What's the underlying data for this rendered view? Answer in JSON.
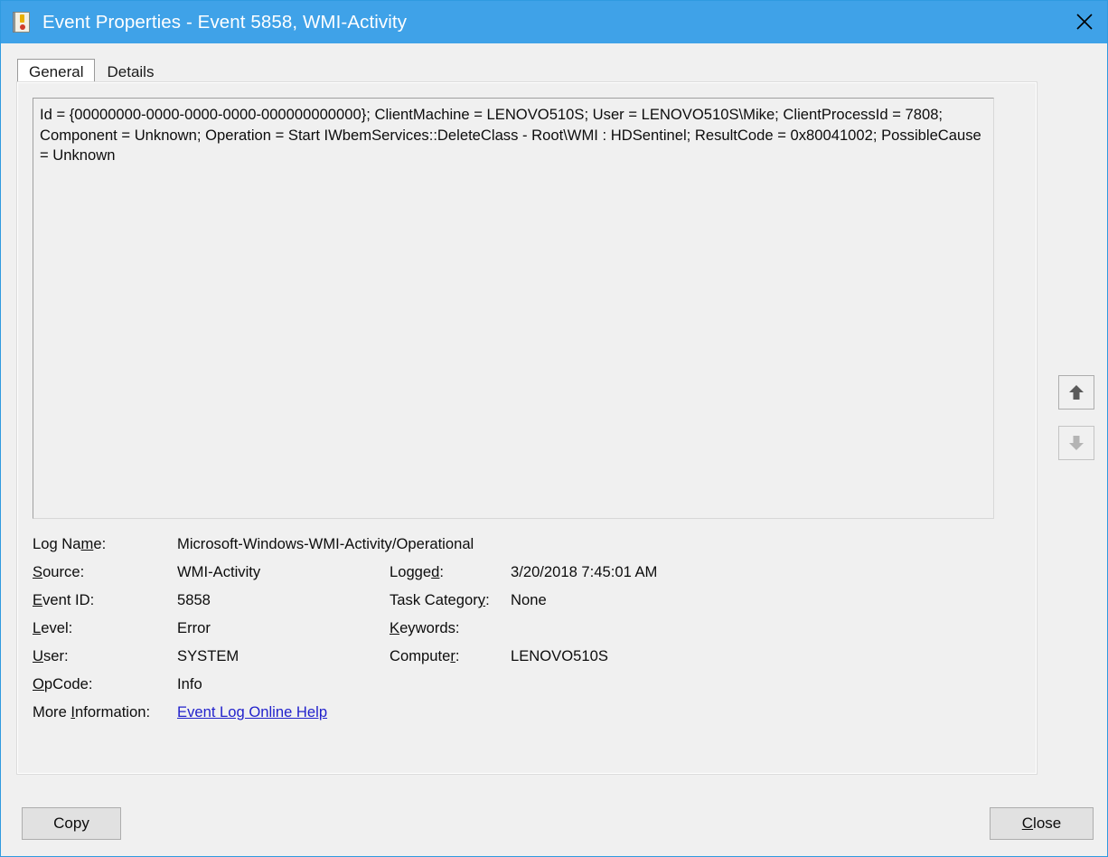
{
  "window": {
    "title": "Event Properties - Event 5858, WMI-Activity",
    "icon": "event-log-icon",
    "close_icon": "close-icon",
    "titlebar_color": "#3fa2e8"
  },
  "tabs": [
    {
      "label": "General",
      "selected": true
    },
    {
      "label": "Details",
      "selected": false
    }
  ],
  "message": {
    "text": "Id = {00000000-0000-0000-0000-000000000000}; ClientMachine = LENOVO510S; User = LENOVO510S\\Mike; ClientProcessId = 7808; Component = Unknown; Operation = Start IWbemServices::DeleteClass - Root\\WMI : HDSentinel; ResultCode = 0x80041002; PossibleCause = Unknown"
  },
  "fields": {
    "log_name_label": "Log Name:",
    "log_name_value": "Microsoft-Windows-WMI-Activity/Operational",
    "source_label": "Source:",
    "source_value": "WMI-Activity",
    "logged_label": "Logged:",
    "logged_value": "3/20/2018 7:45:01 AM",
    "event_id_label": "Event ID:",
    "event_id_value": "5858",
    "task_category_label": "Task Category:",
    "task_category_value": "None",
    "level_label": "Level:",
    "level_value": "Error",
    "keywords_label": "Keywords:",
    "keywords_value": "",
    "user_label": "User:",
    "user_value": "SYSTEM",
    "computer_label": "Computer:",
    "computer_value": "LENOVO510S",
    "opcode_label": "OpCode:",
    "opcode_value": "Info",
    "more_info_label": "More Information:",
    "more_info_link": "Event Log Online Help",
    "link_color": "#2222cc"
  },
  "nav": {
    "up_icon": "arrow-up-icon",
    "down_icon": "arrow-down-icon",
    "up_enabled": true,
    "down_enabled": false
  },
  "footer": {
    "copy_label": "Copy",
    "close_label": "Close"
  }
}
